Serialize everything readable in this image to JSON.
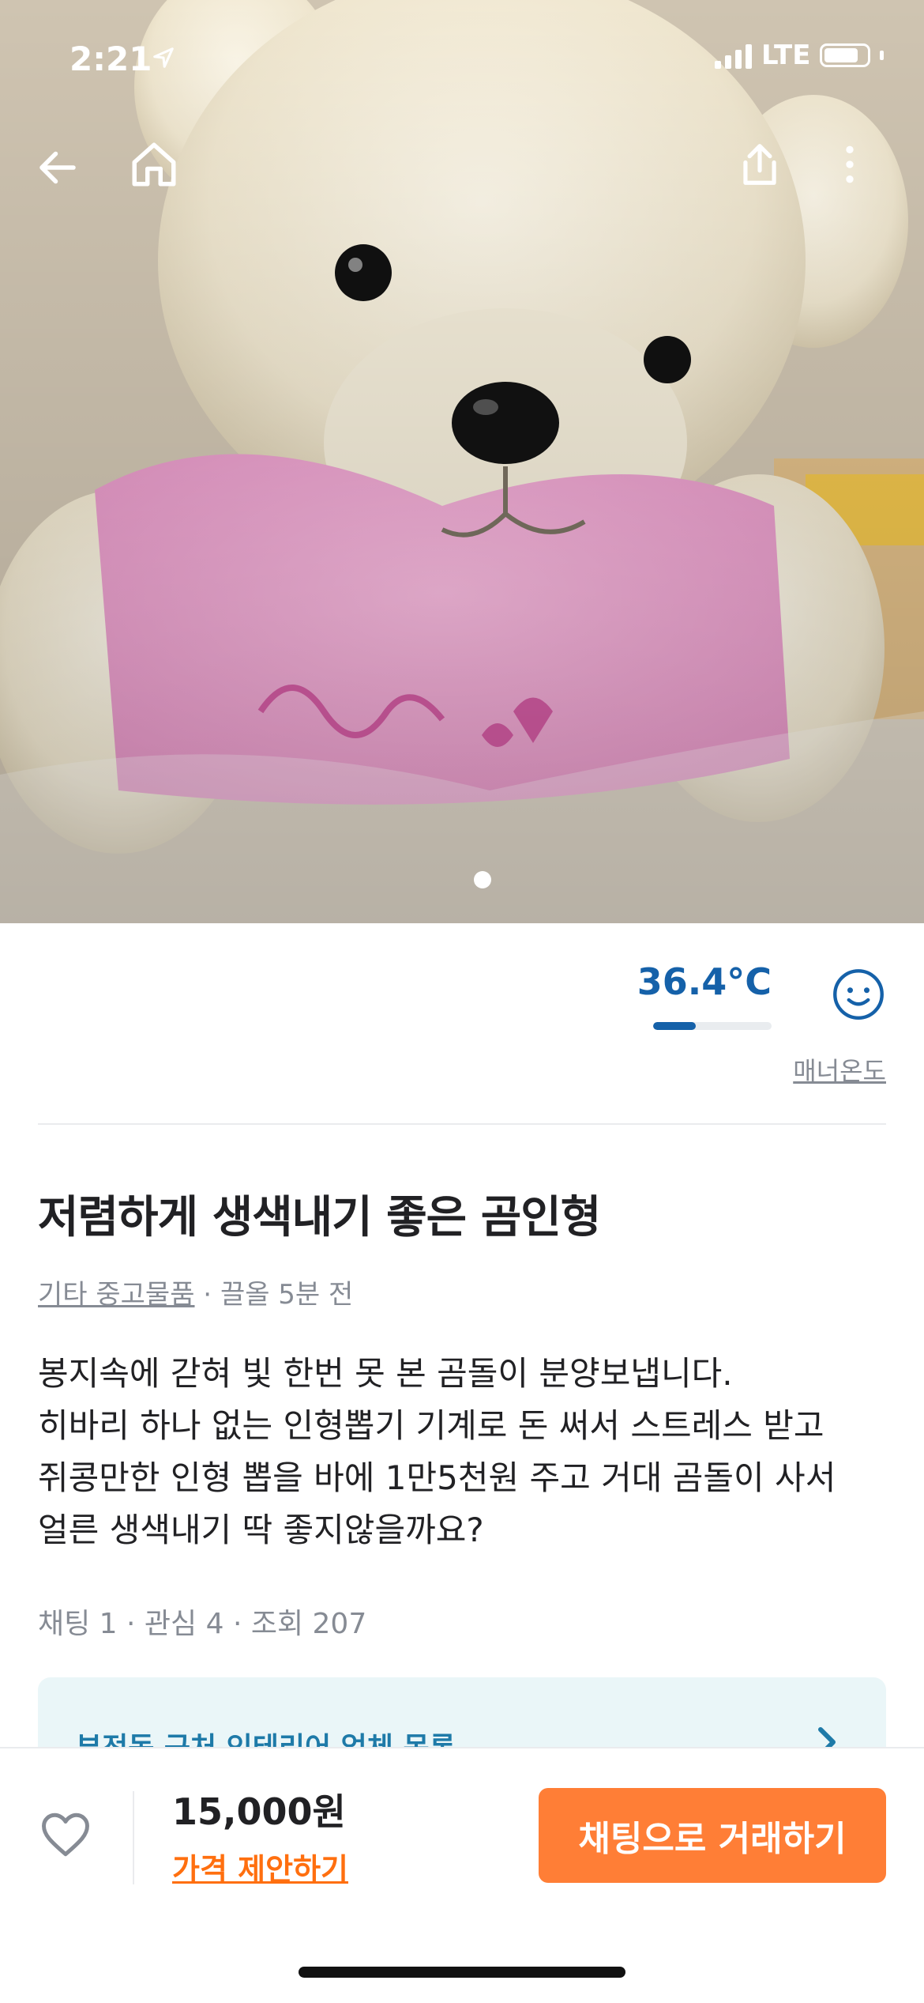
{
  "status_bar": {
    "time": "2:21",
    "network": "LTE"
  },
  "nav": {
    "back_icon": "arrow-left-icon",
    "home_icon": "home-icon",
    "share_icon": "share-icon",
    "more_icon": "more-vertical-icon"
  },
  "gallery": {
    "image_description_icon": "teddy-bear-photo",
    "page_count": 1,
    "current_page": 1
  },
  "seller": {
    "manner_temperature": "36.4°C",
    "manner_level": 0.36,
    "manner_label": "매너온도",
    "manner_face_icon": "smile-face-icon"
  },
  "post": {
    "title": "저렴하게 생색내기 좋은 곰인형",
    "category": "기타 중고물품",
    "meta_sep": " · ",
    "time": "끌올 5분 전",
    "description_lines": [
      "봉지속에 갇혀 빛 한번 못 본 곰돌이 분양보냅니다.",
      "히바리 하나 없는 인형뽑기 기계로 돈 써서 스트레스 받고",
      "쥐콩만한 인형 뽑을 바에 1만5천원 주고 거대 곰돌이 사서",
      "얼른 생색내기 딱 좋지않을까요?"
    ],
    "stats": "채팅 1 · 관심 4 · 조회 207"
  },
  "banner": {
    "text": "부전동 근처 인테리어 업체 목록"
  },
  "bottom_bar": {
    "favorite_icon": "heart-outline-icon",
    "price": "15,000원",
    "offer_label": "가격 제안하기",
    "chat_button": "채팅으로 거래하기"
  },
  "colors": {
    "accent": "#ff7e36",
    "offer": "#ff6f0f",
    "manner_blue": "#1561a9"
  }
}
